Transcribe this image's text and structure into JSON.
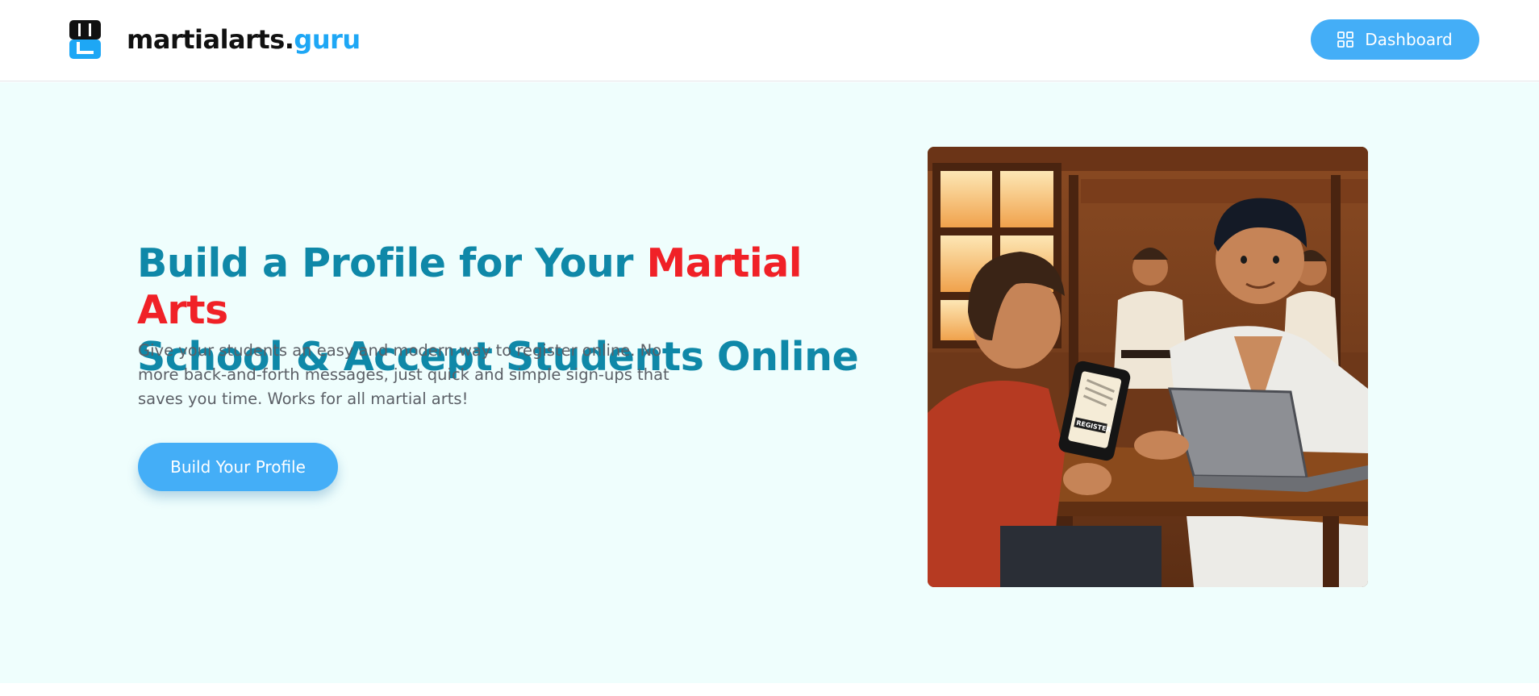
{
  "header": {
    "brand_main": "martialarts.",
    "brand_accent": "guru",
    "logo_icon": "martialarts-guru-logo",
    "dashboard_label": "Dashboard",
    "dashboard_icon": "grid-icon"
  },
  "hero": {
    "headline_part1": "Build a Profile for Your ",
    "headline_accent": "Martial Arts",
    "headline_part2": "School & Accept Students Online",
    "subtext": "Give your students an easy and modern way to register online. No more back-and-forth messages, just quick and simple sign-ups that saves you time. Works for all martial arts!",
    "cta_label": "Build Your Profile",
    "image_phone_text": "REGISTER"
  },
  "colors": {
    "accent_blue": "#44aef7",
    "headline_teal": "#0f88a8",
    "headline_red": "#f02127",
    "hero_background": "#effefd"
  }
}
